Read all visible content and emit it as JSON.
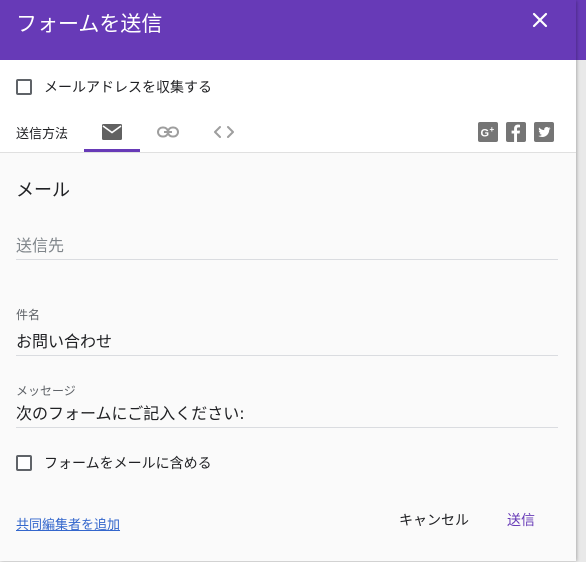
{
  "dialog": {
    "title": "フォームを送信",
    "close_icon": "close-icon",
    "accent_color": "#673ab7"
  },
  "collect_email": {
    "label": "メールアドレスを収集する",
    "checked": false
  },
  "send_via": {
    "label": "送信方法",
    "tabs": [
      {
        "icon": "email-icon",
        "active": true
      },
      {
        "icon": "link-icon",
        "active": false
      },
      {
        "icon": "embed-code-icon",
        "active": false
      }
    ],
    "share_icons": [
      "google-plus-icon",
      "facebook-icon",
      "twitter-icon"
    ]
  },
  "email": {
    "section_title": "メール",
    "to_placeholder": "送信先",
    "subject_label": "件名",
    "subject_value": "お問い合わせ",
    "message_label": "メッセージ",
    "message_value": "次のフォームにご記入ください:",
    "include_form_label": "フォームをメールに含める",
    "include_form_checked": false
  },
  "footer": {
    "add_collaborators": "共同編集者を追加",
    "cancel": "キャンセル",
    "send": "送信"
  }
}
